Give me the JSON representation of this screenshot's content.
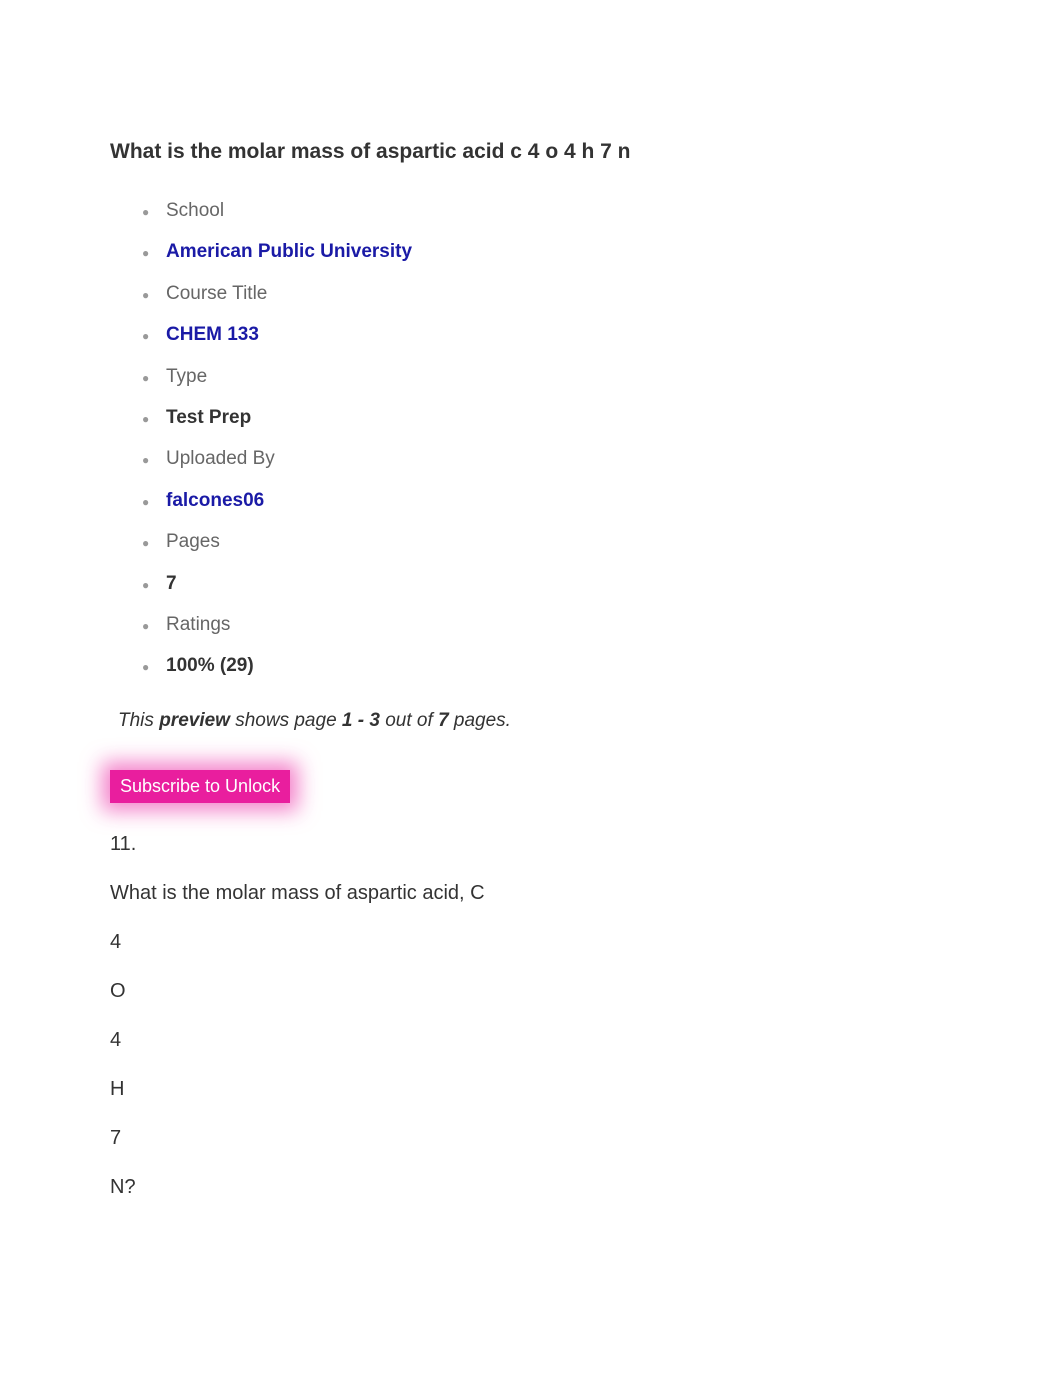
{
  "title": "What is the molar mass of aspartic acid c 4 o 4 h 7 n",
  "meta": {
    "school_label": "School",
    "school_value": "American Public University",
    "course_label": "Course Title",
    "course_value": "CHEM 133",
    "type_label": "Type",
    "type_value": "Test Prep",
    "uploaded_label": "Uploaded By",
    "uploaded_value": "falcones06",
    "pages_label": "Pages",
    "pages_value": "7",
    "ratings_label": "Ratings",
    "ratings_value": " 100% (29)"
  },
  "preview": {
    "prefix": "This ",
    "preview_word": "preview",
    "mid1": " shows page ",
    "range": "1 - 3",
    "mid2": " out of ",
    "total": "7",
    "suffix": " pages."
  },
  "subscribe_label": "Subscribe to Unlock",
  "content": {
    "qnum": "11.",
    "qtext": "What is the molar mass of aspartic acid, C",
    "f1": "4",
    "f2": "O",
    "f3": "4",
    "f4": "H",
    "f5": "7",
    "f6": "N?"
  }
}
